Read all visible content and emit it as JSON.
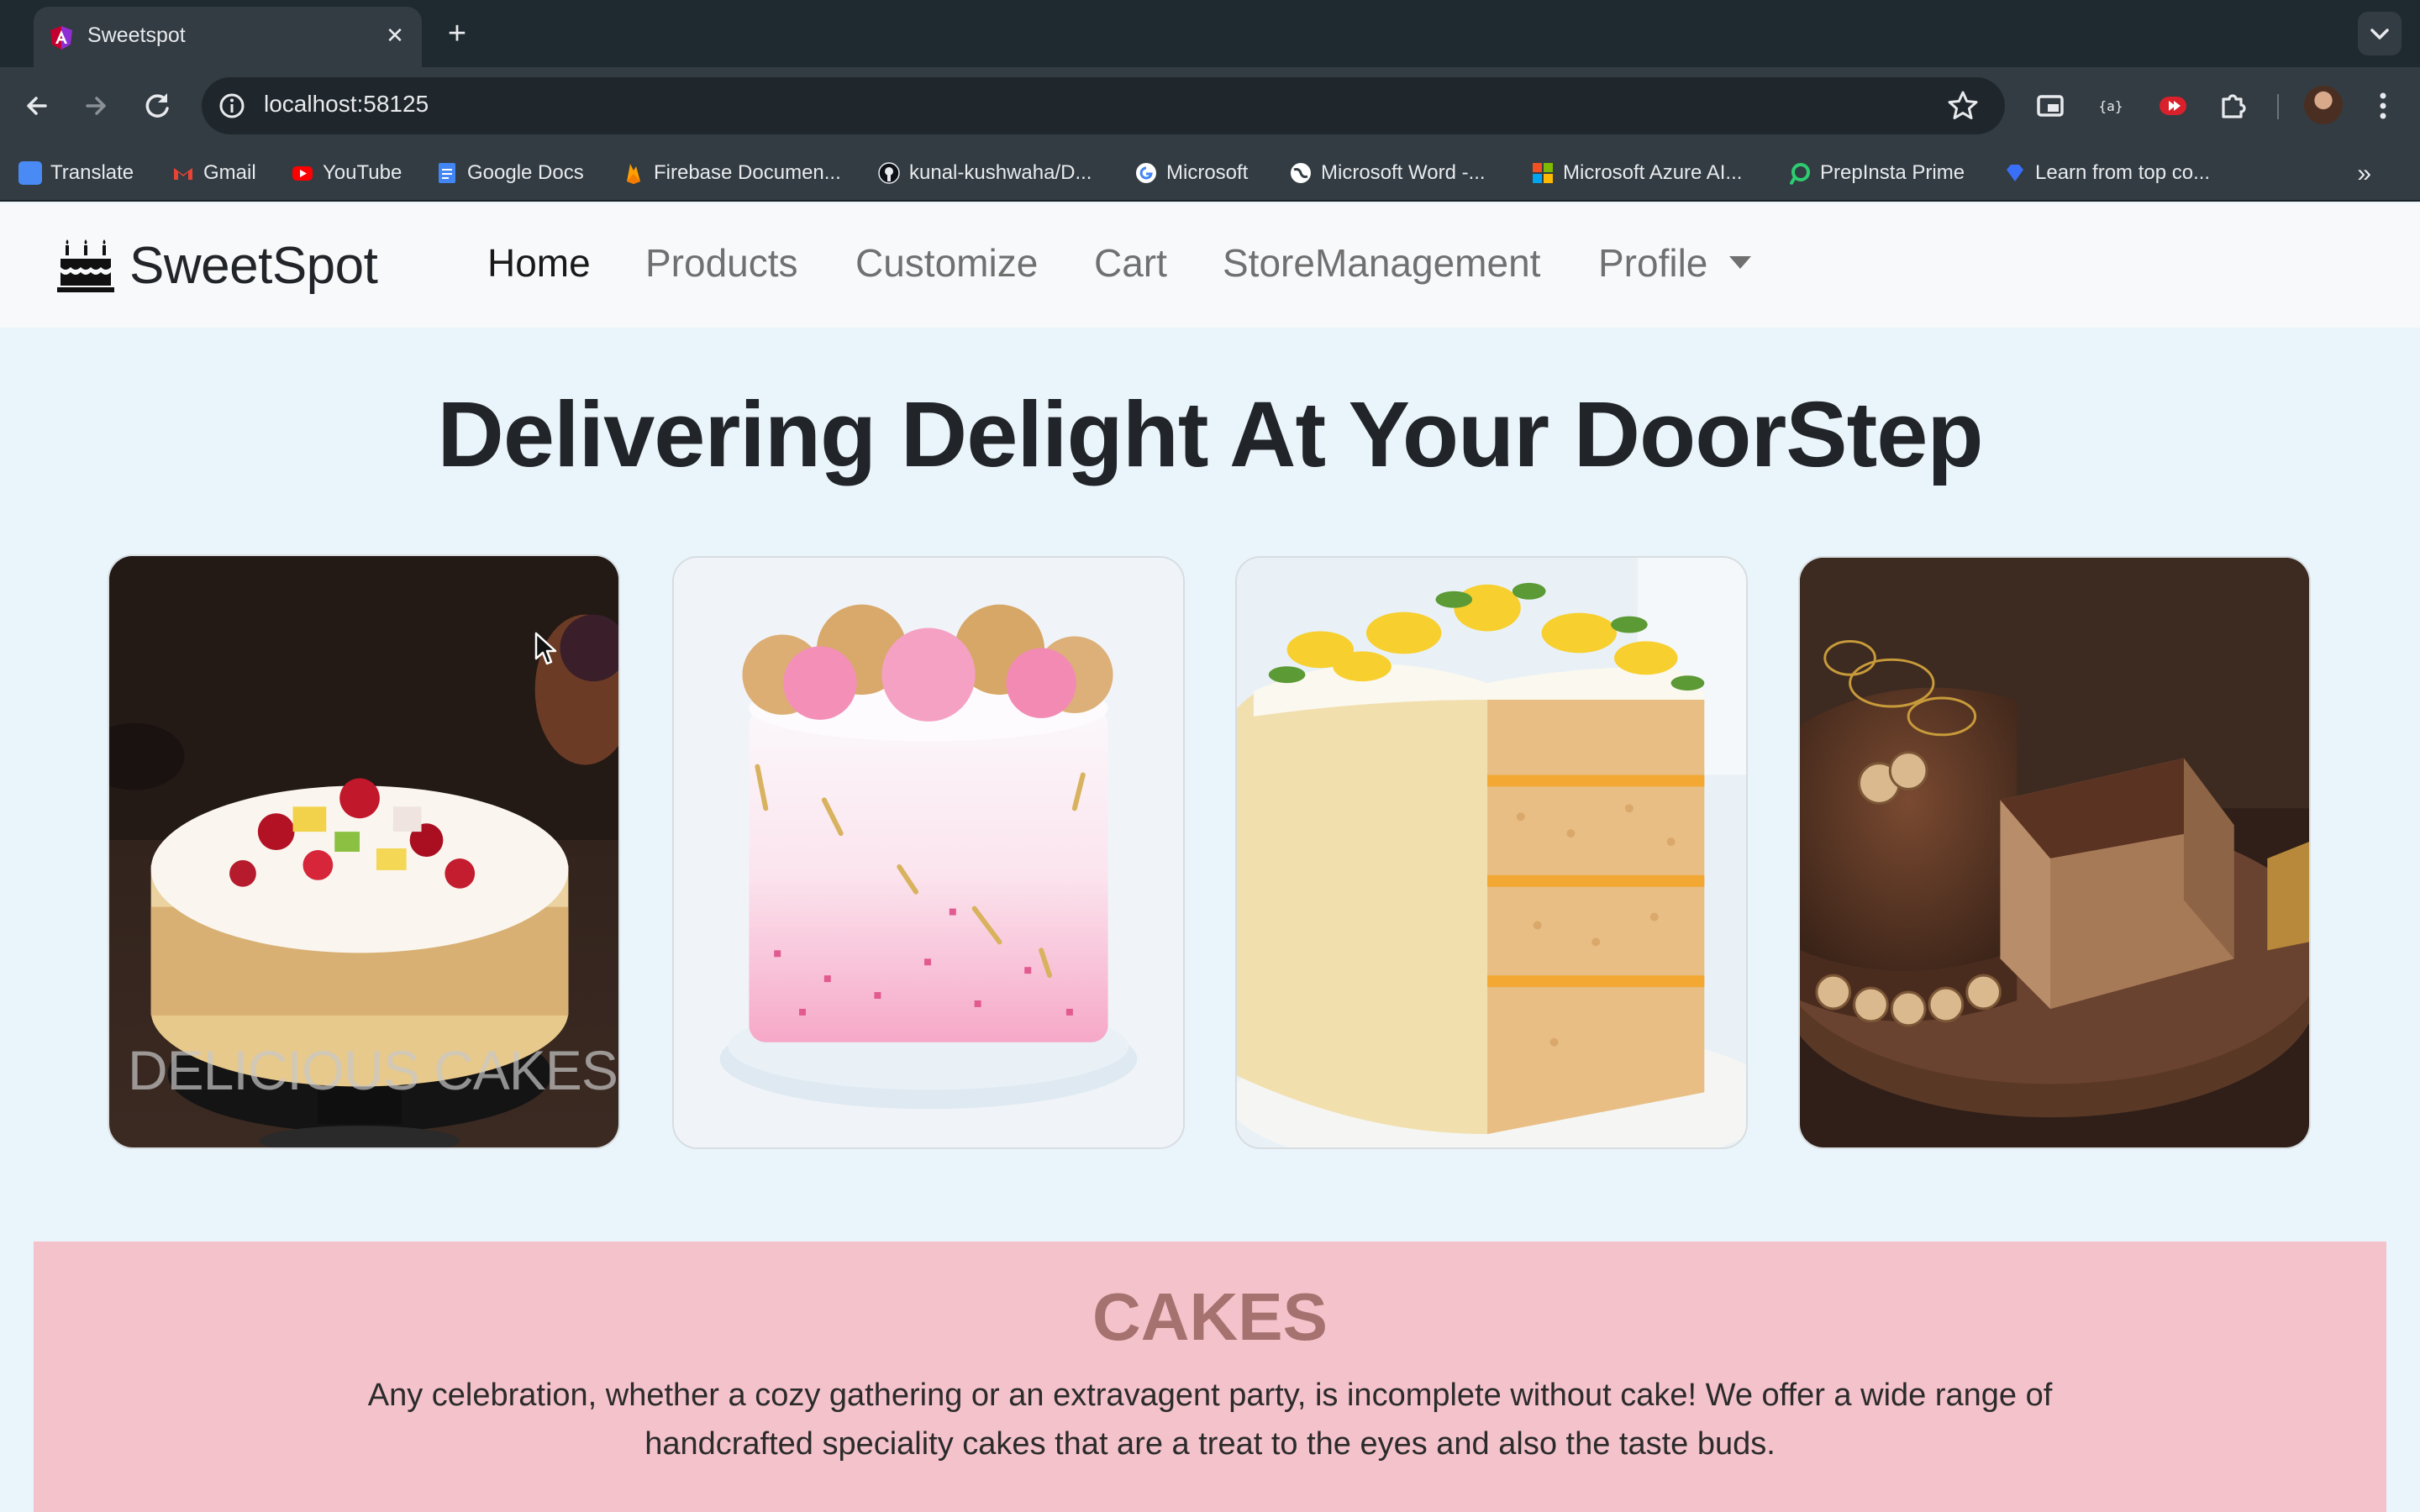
{
  "browser": {
    "tab": {
      "title": "Sweetspot",
      "favicon": "angular-logo-icon"
    },
    "address": {
      "url": "localhost:58125"
    },
    "bookmarks": [
      {
        "label": "Translate",
        "icon": "google-translate-icon",
        "color": "#4a8af4"
      },
      {
        "label": "Gmail",
        "icon": "gmail-icon",
        "color": "#ea4335"
      },
      {
        "label": "YouTube",
        "icon": "youtube-icon",
        "color": "#ff0000"
      },
      {
        "label": "Google Docs",
        "icon": "google-docs-icon",
        "color": "#4285f4"
      },
      {
        "label": "Firebase Documen...",
        "icon": "firebase-icon",
        "color": "#ffa000"
      },
      {
        "label": "kunal-kushwaha/D...",
        "icon": "github-icon",
        "color": "#000000"
      },
      {
        "label": "Microsoft",
        "icon": "google-icon",
        "color": "#ffffff"
      },
      {
        "label": "Microsoft Word -...",
        "icon": "globe-icon",
        "color": "#ffffff"
      },
      {
        "label": "Microsoft Azure AI...",
        "icon": "microsoft-icon",
        "color": "#f25022"
      },
      {
        "label": "PrepInsta Prime",
        "icon": "prepinsta-icon",
        "color": "#2ecc71"
      },
      {
        "label": "Learn from top co...",
        "icon": "diamond-icon",
        "color": "#3a6ff7"
      }
    ]
  },
  "site": {
    "brand": "SweetSpot",
    "nav": {
      "home": "Home",
      "products": "Products",
      "customize": "Customize",
      "cart": "Cart",
      "store": "StoreManagement",
      "profile": "Profile"
    },
    "hero_title": "Delivering Delight At Your DoorStep",
    "cards": [
      {
        "caption": "DELICIOUS CAKES",
        "image": "fruit-cake-photo"
      },
      {
        "caption": "",
        "image": "pink-sprinkle-cake-photo"
      },
      {
        "caption": "",
        "image": "lemon-layer-cake-photo"
      },
      {
        "caption": "",
        "image": "chocolate-hazelnut-cake-photo"
      }
    ],
    "cakes_section": {
      "heading": "CAKES",
      "description": "Any celebration, whether a cozy gathering or an extravagent party, is incomplete without cake! We offer a wide range of handcrafted speciality cakes that are a treat to the eyes and also the taste buds."
    }
  },
  "colors": {
    "page_bg": "#eaf5fb",
    "navbar_bg": "#f8f9fa",
    "cakes_bg": "#f4c2cb",
    "cakes_heading": "#a6726f",
    "browser_dark": "#1f2a30",
    "browser_toolbar": "#323c42"
  }
}
